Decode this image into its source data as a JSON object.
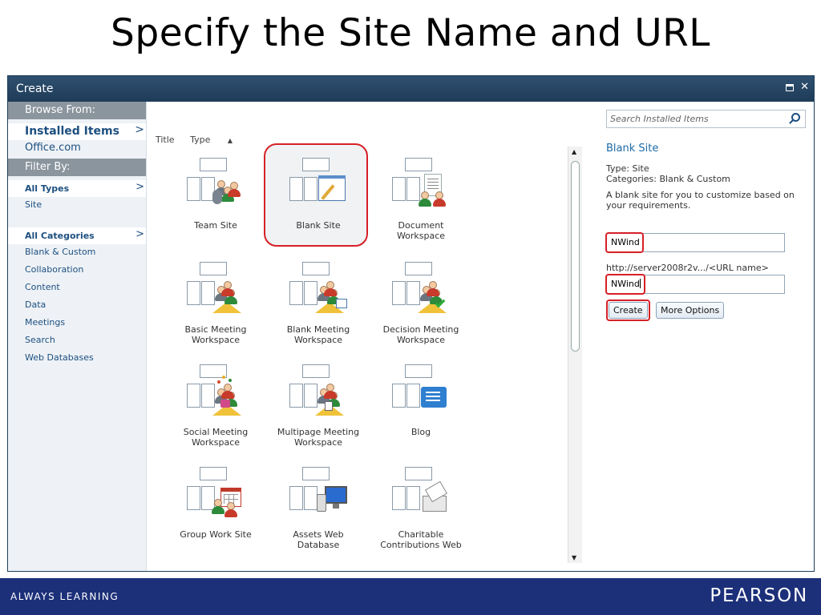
{
  "slide": {
    "title": "Specify the Site Name and URL"
  },
  "dialog": {
    "title": "Create"
  },
  "left_nav": {
    "browse_header": "Browse From:",
    "browse_items": [
      {
        "label": "Installed Items",
        "selected": true
      },
      {
        "label": "Office.com",
        "selected": false
      }
    ],
    "filter_header": "Filter By:",
    "type_items": [
      {
        "label": "All Types",
        "selected": true
      },
      {
        "label": "Site",
        "selected": false
      }
    ],
    "category_items": [
      {
        "label": "All Categories",
        "selected": true
      },
      {
        "label": "Blank & Custom",
        "selected": false
      },
      {
        "label": "Collaboration",
        "selected": false
      },
      {
        "label": "Content",
        "selected": false
      },
      {
        "label": "Data",
        "selected": false
      },
      {
        "label": "Meetings",
        "selected": false
      },
      {
        "label": "Search",
        "selected": false
      },
      {
        "label": "Web Databases",
        "selected": false
      }
    ]
  },
  "sort": {
    "title_label": "Title",
    "type_label": "Type",
    "type_arrow": "▲"
  },
  "templates": [
    {
      "label": "Team Site",
      "icon": "team-site-icon",
      "selected": false
    },
    {
      "label": "Blank Site",
      "icon": "blank-site-icon",
      "selected": true
    },
    {
      "label": "Document Workspace",
      "icon": "document-workspace-icon",
      "selected": false
    },
    {
      "label": "Basic Meeting Workspace",
      "icon": "basic-meeting-icon",
      "selected": false
    },
    {
      "label": "Blank Meeting Workspace",
      "icon": "blank-meeting-icon",
      "selected": false
    },
    {
      "label": "Decision Meeting Workspace",
      "icon": "decision-meeting-icon",
      "selected": false
    },
    {
      "label": "Social Meeting Workspace",
      "icon": "social-meeting-icon",
      "selected": false
    },
    {
      "label": "Multipage Meeting Workspace",
      "icon": "multipage-meeting-icon",
      "selected": false
    },
    {
      "label": "Blog",
      "icon": "blog-icon",
      "selected": false
    },
    {
      "label": "Group Work Site",
      "icon": "group-work-icon",
      "selected": false
    },
    {
      "label": "Assets Web Database",
      "icon": "assets-database-icon",
      "selected": false
    },
    {
      "label": "Charitable Contributions Web",
      "icon": "charitable-contributions-icon",
      "selected": false
    }
  ],
  "details": {
    "search_placeholder": "Search Installed Items",
    "title": "Blank Site",
    "type_line": "Type: Site",
    "categories_line": "Categories: Blank & Custom",
    "description": "A blank site for you to customize based on your requirements.",
    "name_value": "NWind",
    "url_prefix": "http://server2008r2v.../<URL name>",
    "url_value": "NWind",
    "create_label": "Create",
    "more_options_label": "More Options"
  },
  "footer": {
    "left_text": "ALWAYS LEARNING",
    "right_text": "PEARSON"
  },
  "colors": {
    "highlight": "#d62027",
    "titlebar": "#1e3c58",
    "footer": "#1c2f79",
    "link": "#1d4f80"
  }
}
